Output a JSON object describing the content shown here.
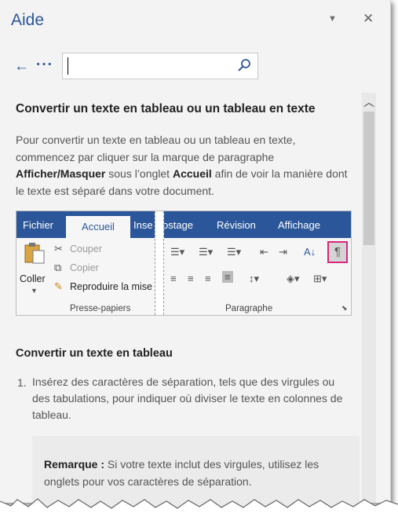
{
  "header": {
    "title": "Aide",
    "dropdown_glyph": "▼",
    "close_glyph": "✕"
  },
  "nav": {
    "back_glyph": "←",
    "more_glyph": "···"
  },
  "search": {
    "value": "",
    "placeholder": ""
  },
  "article": {
    "title": "Convertir un texte en tableau ou un tableau en texte",
    "intro_part1": "Pour convertir un texte en tableau ou un tableau en texte, commencez par cliquer sur la marque de paragraphe ",
    "intro_bold1": "Afficher/Masquer",
    "intro_part2": " sous l’onglet ",
    "intro_bold2": "Accueil",
    "intro_part3": " afin de voir la manière dont le texte est séparé dans votre document."
  },
  "ribbon": {
    "tabs": [
      "Fichier",
      "Accueil",
      "Inse",
      "ostage",
      "Révision",
      "Affichage"
    ],
    "paste_label": "Coller",
    "cut_label": "Couper",
    "copy_label": "Copier",
    "format_painter_label": "Reproduire la mise",
    "clipboard_group": "Presse-papiers",
    "paragraph_group": "Paragraphe"
  },
  "section": {
    "heading": "Convertir un texte en tableau",
    "step_number": "1.",
    "step_text": "Insérez des caractères de séparation, tels que des virgules ou des tabulations, pour indiquer où diviser le texte en colonnes de tableau.",
    "note_label": "Remarque :",
    "note_text": " Si votre texte inclut des virgules, utilisez les onglets pour vos caractères de séparation."
  },
  "colors": {
    "accent": "#2b579a",
    "pane_bg": "#f3f3f3",
    "highlight": "#d7287e"
  }
}
